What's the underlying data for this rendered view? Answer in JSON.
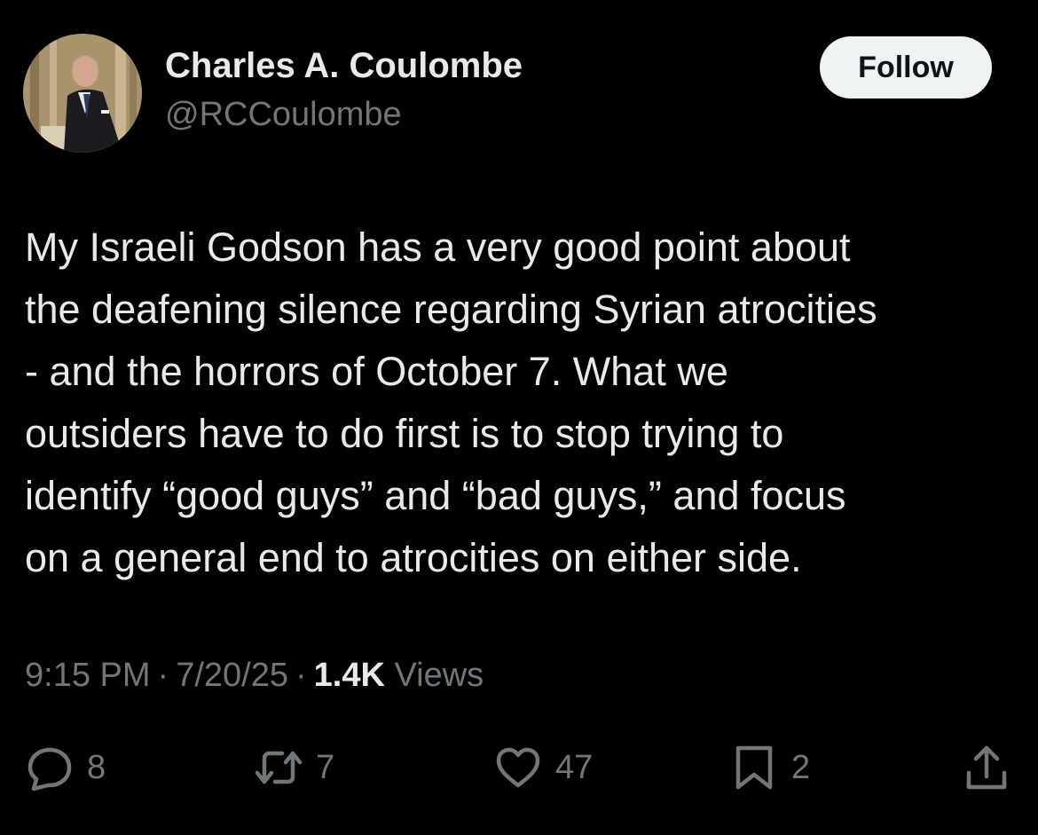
{
  "author": {
    "name": "Charles A. Coulombe",
    "handle": "@RCCoulombe",
    "follow_label": "Follow"
  },
  "tweet": {
    "lines": [
      "My Israeli Godson has a very good point about",
      "the deafening silence regarding Syrian atrocities",
      "- and the horrors of October 7. What we",
      "outsiders have to do first is to stop trying to",
      "identify “good guys” and “bad guys,” and focus",
      "on a general end to atrocities on either side."
    ]
  },
  "meta": {
    "time": "9:15 PM",
    "date": "7/20/25",
    "separator": "·",
    "views_count": "1.4K",
    "views_label": "Views"
  },
  "actions": {
    "replies": "8",
    "reposts": "7",
    "likes": "47",
    "bookmarks": "2"
  },
  "icons": [
    "reply-icon",
    "repost-icon",
    "like-icon",
    "bookmark-icon",
    "share-icon"
  ],
  "colors": {
    "background": "#000000",
    "text": "#e7e9ea",
    "muted": "#71767b",
    "follow_bg": "#eff3f4"
  }
}
